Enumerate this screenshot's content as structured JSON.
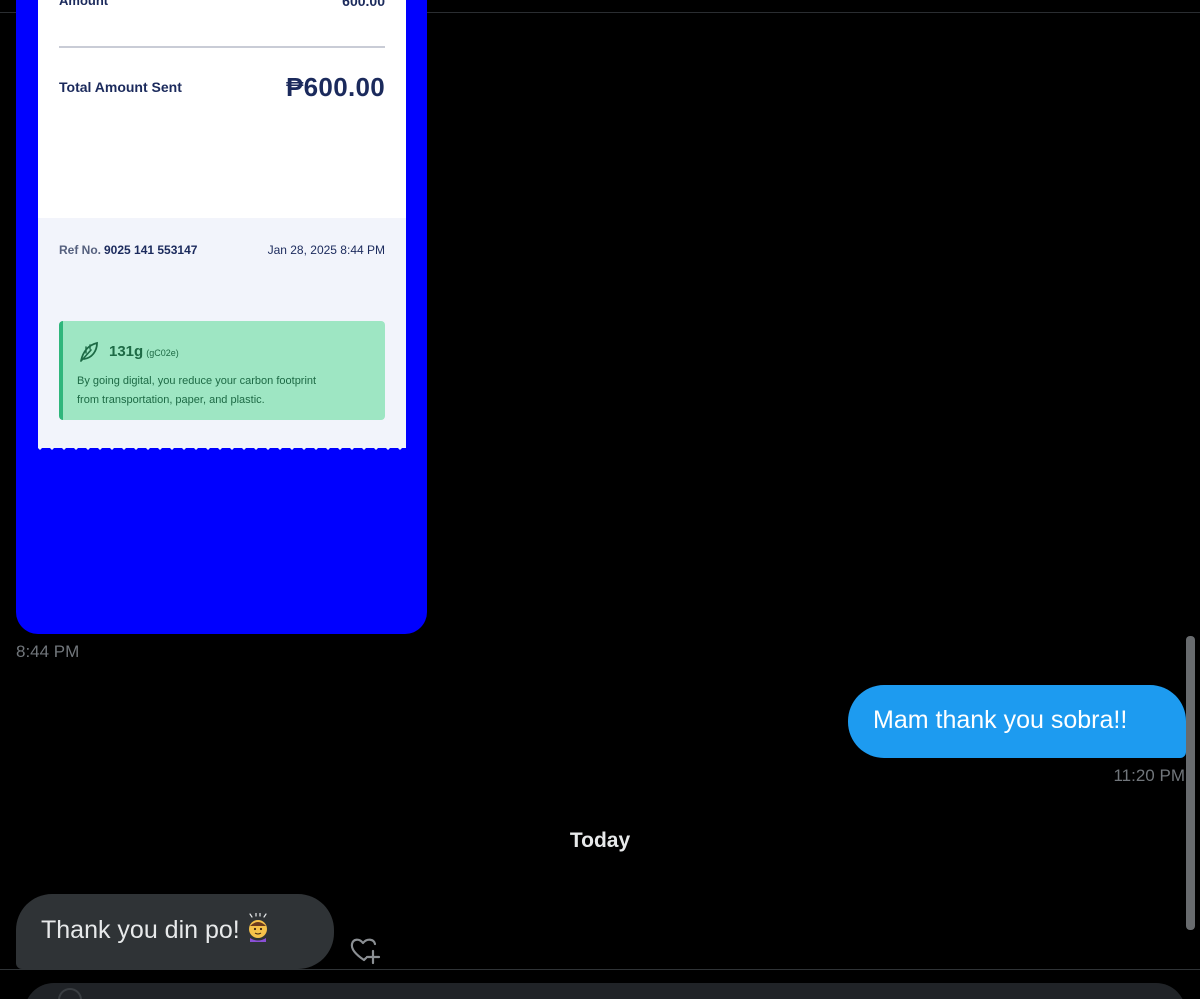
{
  "receipt": {
    "amount_label": "Amount",
    "amount_value": "600.00",
    "total_label": "Total Amount Sent",
    "total_value": "₱600.00",
    "ref_label": "Ref No.",
    "ref_number": "9025 141 553147",
    "ref_datetime": "Jan 28, 2025 8:44 PM",
    "carbon": {
      "amount": "131g",
      "unit": "(gC02e)",
      "line1": "By going digital, you reduce your carbon footprint",
      "line2": "from transportation, paper, and plastic."
    }
  },
  "messages": {
    "image_time": "8:44 PM",
    "outgoing_text": "Mam thank you sobra!!",
    "outgoing_time": "11:20 PM",
    "day_divider": "Today",
    "incoming_text": "Thank you din po!",
    "incoming_emoji": "face-with-halo-emoji"
  },
  "colors": {
    "background": "#000000",
    "receipt_bg": "#0000ff",
    "outgoing_bubble": "#1d9bf0",
    "incoming_bubble": "#2f3336",
    "timestamp": "#71767b",
    "carbon_card": "#9ee6c3"
  },
  "icons": {
    "reaction": "heart-add-icon",
    "leaf": "leaf-icon"
  }
}
